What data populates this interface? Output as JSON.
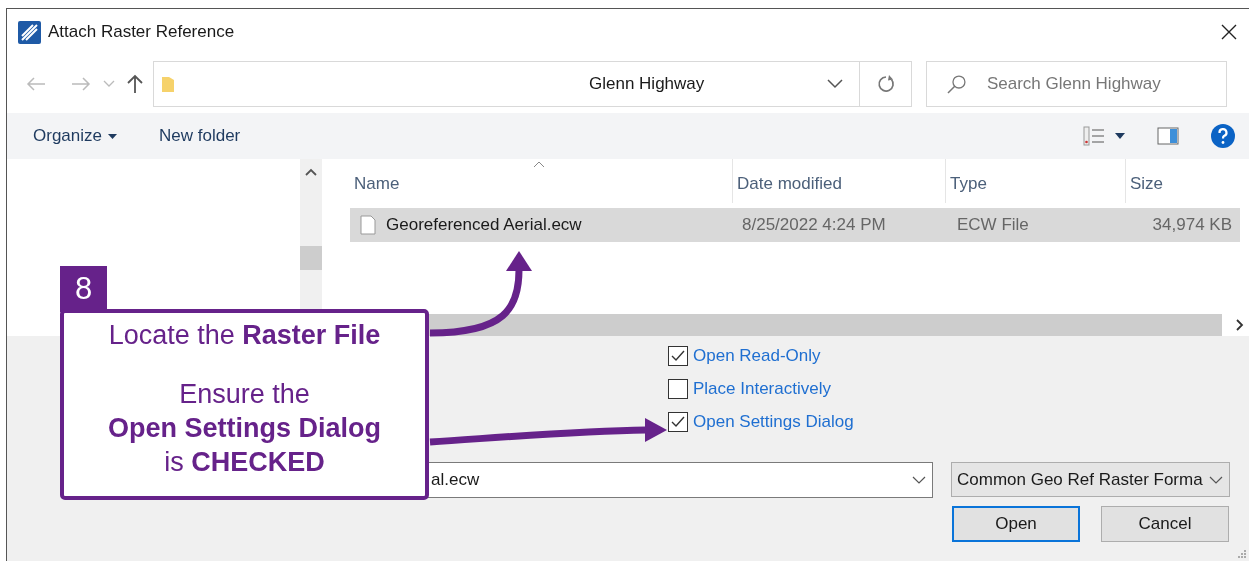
{
  "window": {
    "title": "Attach Raster Reference"
  },
  "address": {
    "path": "Glenn Highway"
  },
  "search": {
    "placeholder": "Search Glenn Highway"
  },
  "toolbar": {
    "items": [
      {
        "label": "Organize",
        "kind": "menu"
      },
      {
        "label": "New folder",
        "kind": "plain"
      }
    ]
  },
  "file_list": {
    "columns": [
      "Name",
      "Date modified",
      "Type",
      "Size"
    ],
    "rows": [
      {
        "name": "Georeferenced Aerial.ecw",
        "date": "8/25/2022 4:24 PM",
        "type": "ECW File",
        "size": "34,974 KB",
        "selected": true
      }
    ]
  },
  "options": [
    {
      "label": "Open Read-Only",
      "checked": true
    },
    {
      "label": "Place Interactively",
      "checked": false
    },
    {
      "label": "Open Settings Dialog",
      "checked": true
    }
  ],
  "file_name": {
    "value": "al.ecw"
  },
  "file_type": {
    "value": "Common Geo Ref Raster Forma"
  },
  "buttons": [
    {
      "label": "Open",
      "kind": "primary"
    },
    {
      "label": "Cancel",
      "kind": "normal"
    }
  ],
  "callout": {
    "number": "8",
    "paragraphs": [
      "Locate the **Raster File**",
      "Ensure the\n**Open Settings Dialog**\nis **CHECKED**"
    ]
  }
}
